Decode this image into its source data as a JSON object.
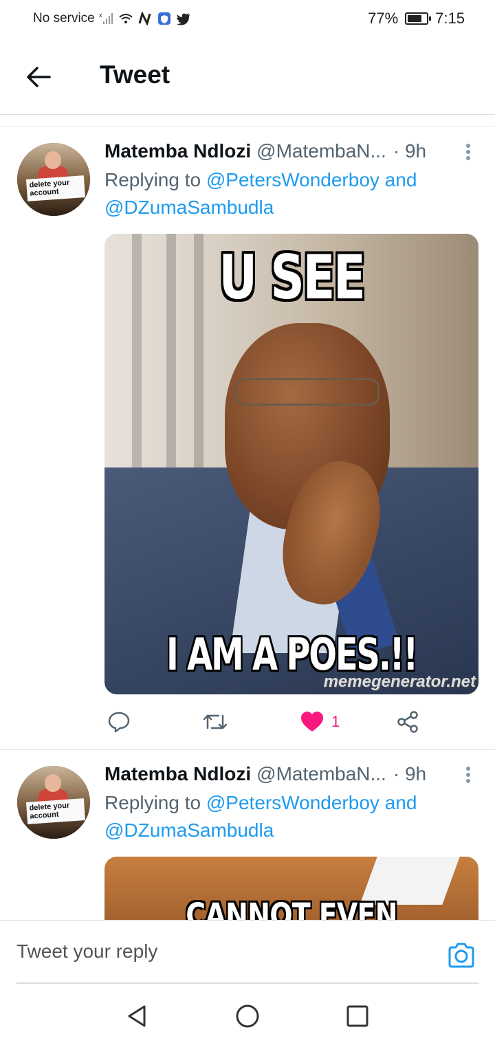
{
  "status_bar": {
    "carrier": "No service",
    "battery": "77%",
    "battery_level": 0.77,
    "time": "7:15"
  },
  "header": {
    "title": "Tweet"
  },
  "tweets": [
    {
      "name": "Matemba Ndlozi",
      "handle": "@MatembaN...",
      "time": "· 9h",
      "reply_prefix": "Replying to",
      "mention_1": "@PetersWonderboy",
      "reply_and": "and",
      "mention_2": "@DZumaSambudla",
      "avatar_sign": "delete your account",
      "meme_top": "U SEE",
      "meme_bottom": "I AM A POES.!!",
      "watermark": "memegenerator.net",
      "likes": "1"
    },
    {
      "name": "Matemba Ndlozi",
      "handle": "@MatembaN...",
      "time": "· 9h",
      "reply_prefix": "Replying to",
      "mention_1": "@PetersWonderboy",
      "reply_and": "and",
      "mention_2": "@DZumaSambudla",
      "avatar_sign": "delete your account",
      "meme_top": "CANNOT EVEN COUNT"
    }
  ],
  "reply_box": {
    "placeholder": "Tweet your reply"
  },
  "icons": {
    "back": "back-arrow-icon",
    "more": "more-vertical-icon",
    "reply": "reply-icon",
    "retweet": "retweet-icon",
    "like": "heart-icon",
    "share": "share-icon",
    "camera": "camera-icon"
  },
  "colors": {
    "accent": "#1d9bf0",
    "like": "#f91880",
    "secondary_text": "#536471"
  }
}
